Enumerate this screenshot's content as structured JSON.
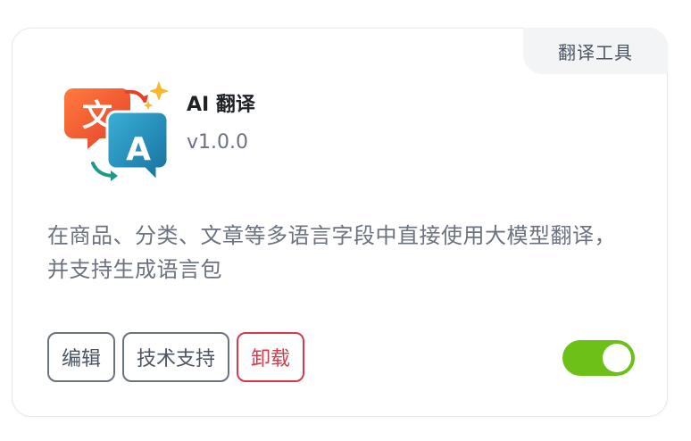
{
  "card": {
    "category_badge": "翻译工具",
    "app_name": "AI 翻译",
    "version": "v1.0.0",
    "description": "在商品、分类、文章等多语言字段中直接使用大模型翻译，并支持生成语言包",
    "icon": {
      "name": "translate-icon",
      "glyph_left": "文",
      "glyph_right": "A",
      "colors": {
        "left_bubble": "#f0582c",
        "right_bubble": "#1f8fb8",
        "sparkle": "#f5b82e"
      }
    },
    "actions": {
      "edit_label": "编辑",
      "support_label": "技术支持",
      "uninstall_label": "卸载"
    },
    "toggle": {
      "enabled": true,
      "on_color": "#6cc017"
    }
  }
}
